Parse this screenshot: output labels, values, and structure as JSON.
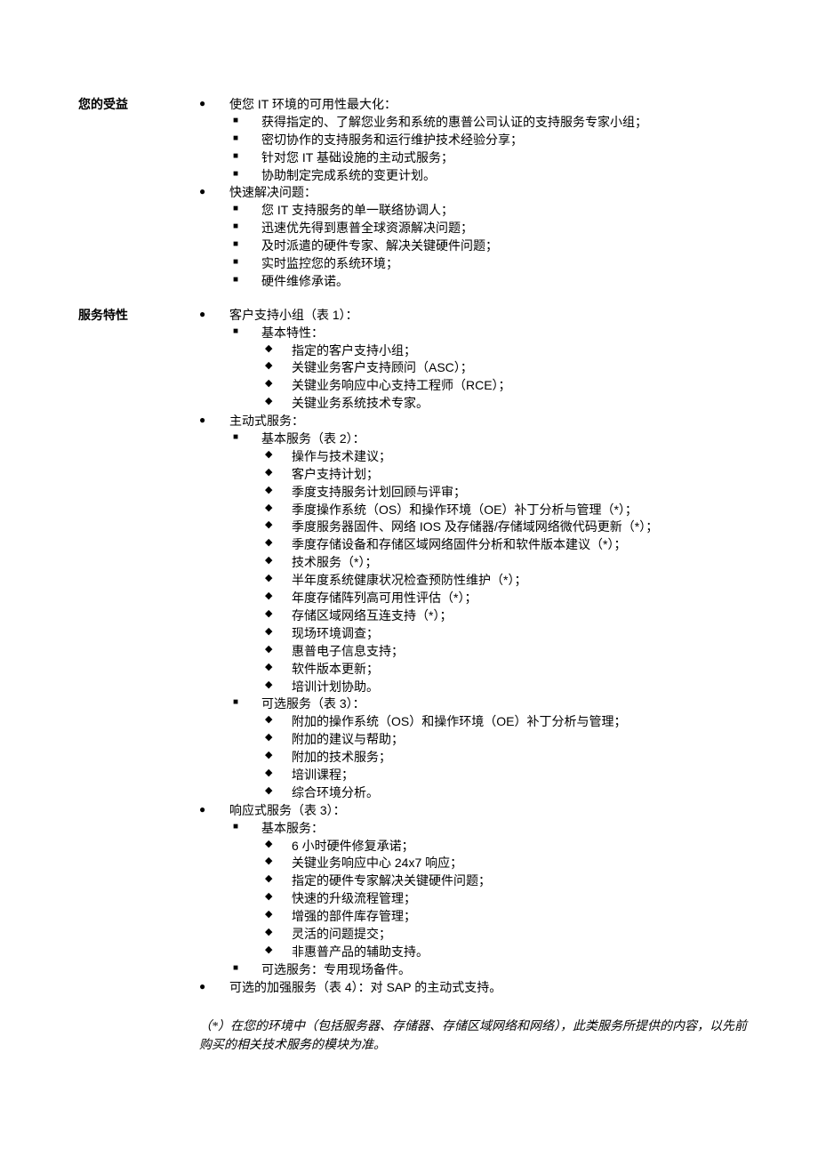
{
  "sections": [
    {
      "label": "您的受益",
      "items": [
        {
          "text": "使您 IT 环境的可用性最大化：",
          "sub": [
            {
              "text": "获得指定的、了解您业务和系统的惠普公司认证的支持服务专家小组；"
            },
            {
              "text": "密切协作的支持服务和运行维护技术经验分享；"
            },
            {
              "text": "针对您 IT 基础设施的主动式服务；"
            },
            {
              "text": "协助制定完成系统的变更计划。"
            }
          ]
        },
        {
          "text": "快速解决问题：",
          "sub": [
            {
              "text": "您 IT 支持服务的单一联络协调人；"
            },
            {
              "text": "迅速优先得到惠普全球资源解决问题；"
            },
            {
              "text": "及时派遣的硬件专家、解决关键硬件问题；"
            },
            {
              "text": "实时监控您的系统环境；"
            },
            {
              "text": "硬件维修承诺。"
            }
          ]
        }
      ]
    },
    {
      "label": "服务特性",
      "items": [
        {
          "text": "客户支持小组（表 1）：",
          "sub": [
            {
              "text": "基本特性：",
              "sub": [
                {
                  "text": "指定的客户支持小组；"
                },
                {
                  "text": "关键业务客户支持顾问（ASC）；"
                },
                {
                  "text": "关键业务响应中心支持工程师（RCE）；"
                },
                {
                  "text": "关键业务系统技术专家。"
                }
              ]
            }
          ]
        },
        {
          "text": "主动式服务：",
          "sub": [
            {
              "text": "基本服务（表 2）：",
              "sub": [
                {
                  "text": "操作与技术建议；"
                },
                {
                  "text": "客户支持计划；"
                },
                {
                  "text": "季度支持服务计划回顾与评审；"
                },
                {
                  "text": "季度操作系统（OS）和操作环境（OE）补丁分析与管理（*）；"
                },
                {
                  "text": "季度服务器固件、网络 IOS 及存储器/存储域网络微代码更新（*）；"
                },
                {
                  "text": "季度存储设备和存储区域网络固件分析和软件版本建议（*）；"
                },
                {
                  "text": "技术服务（*）；"
                },
                {
                  "text": "半年度系统健康状况检查预防性维护（*）；"
                },
                {
                  "text": "年度存储阵列高可用性评估（*）；"
                },
                {
                  "text": "存储区域网络互连支持（*）；"
                },
                {
                  "text": "现场环境调查；"
                },
                {
                  "text": "惠普电子信息支持；"
                },
                {
                  "text": "软件版本更新；"
                },
                {
                  "text": "培训计划协助。"
                }
              ]
            },
            {
              "text": "可选服务（表 3）：",
              "sub": [
                {
                  "text": "附加的操作系统（OS）和操作环境（OE）补丁分析与管理；"
                },
                {
                  "text": "附加的建议与帮助；"
                },
                {
                  "text": "附加的技术服务；"
                },
                {
                  "text": "培训课程；"
                },
                {
                  "text": "综合环境分析。"
                }
              ]
            }
          ]
        },
        {
          "text": "响应式服务（表 3）：",
          "sub": [
            {
              "text": "基本服务：",
              "sub": [
                {
                  "text": "6 小时硬件修复承诺；"
                },
                {
                  "text": "关键业务响应中心 24x7 响应；"
                },
                {
                  "text": "指定的硬件专家解决关键硬件问题；"
                },
                {
                  "text": "快速的升级流程管理；"
                },
                {
                  "text": "增强的部件库存管理；"
                },
                {
                  "text": "灵活的问题提交；"
                },
                {
                  "text": "非惠普产品的辅助支持。"
                }
              ]
            },
            {
              "text": "可选服务：专用现场备件。"
            }
          ]
        },
        {
          "text": "可选的加强服务（表 4）：对 SAP 的主动式支持。"
        }
      ]
    }
  ],
  "footnote": "（*）在您的环境中（包括服务器、存储器、存储区域网络和网络），此类服务所提供的内容，以先前购买的相关技术服务的模块为准。"
}
